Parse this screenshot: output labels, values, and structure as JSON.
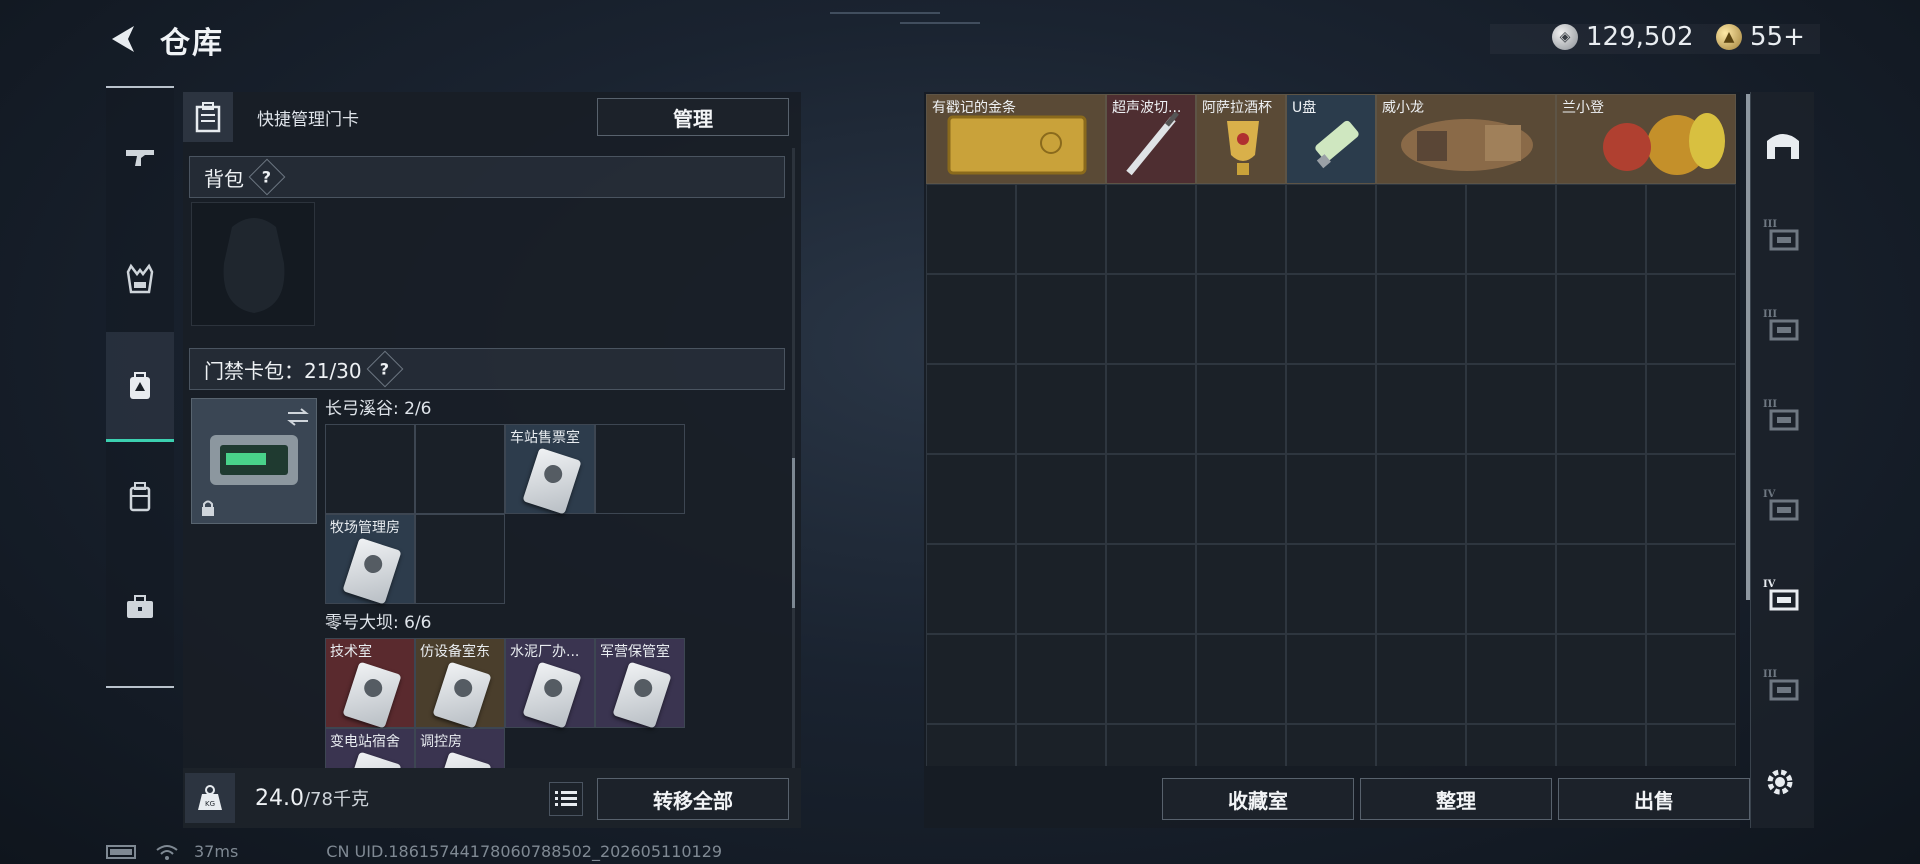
{
  "header": {
    "title": "仓库",
    "silver_amount": "129,502",
    "gold_amount": "55+"
  },
  "left_nav": [
    {
      "icon": "pistol-icon"
    },
    {
      "icon": "vest-icon"
    },
    {
      "icon": "keycard-bag-icon",
      "active": true
    },
    {
      "icon": "backpack-icon"
    },
    {
      "icon": "toolbox-icon"
    }
  ],
  "left_panel": {
    "quick_label": "快捷管理门卡",
    "manage_label": "管理",
    "backpack_section": "背包",
    "keycard_section": "门禁卡包：21/30",
    "help_mark": "?",
    "groups": [
      {
        "title": "长弓溪谷: 2/6",
        "cards": [
          {
            "name": "",
            "color": "empty"
          },
          {
            "name": "",
            "color": "empty"
          },
          {
            "name": "车站售票室",
            "color": "blue"
          },
          {
            "name": "",
            "color": "empty"
          },
          {
            "name": "牧场管理房",
            "color": "blue"
          },
          {
            "name": "",
            "color": "empty"
          }
        ]
      },
      {
        "title": "零号大坝: 6/6",
        "cards": [
          {
            "name": "技术室",
            "color": "red"
          },
          {
            "name": "仿设备室东",
            "color": "gold"
          },
          {
            "name": "水泥厂办...",
            "color": "purple"
          },
          {
            "name": "军营保管室",
            "color": "purple"
          },
          {
            "name": "变电站宿舍",
            "color": "purple"
          },
          {
            "name": "调控房",
            "color": "purple"
          }
        ]
      }
    ],
    "weight_current": "24.0",
    "weight_capacity": "/78千克",
    "transfer_label": "转移全部"
  },
  "storage": {
    "items": [
      {
        "name": "有戳记的金条",
        "color": "gold"
      },
      {
        "name": "超声波切...",
        "color": "red"
      },
      {
        "name": "阿萨拉酒杯",
        "color": "gold"
      },
      {
        "name": "U盘",
        "color": "blue"
      },
      {
        "name": "威小龙",
        "color": "gold"
      },
      {
        "name": "兰小登",
        "color": "gold"
      }
    ],
    "buttons": {
      "collection": "收藏室",
      "sort": "整理",
      "sell": "出售"
    }
  },
  "right_nav": [
    {
      "icon": "vault-icon"
    },
    {
      "icon": "shelf-iii-icon",
      "tier": "III"
    },
    {
      "icon": "case-iii-icon",
      "tier": "III"
    },
    {
      "icon": "rack-iii-icon",
      "tier": "III"
    },
    {
      "icon": "folder-iv-icon",
      "tier": "IV"
    },
    {
      "icon": "gear-tier-iv-icon",
      "tier": "IV"
    },
    {
      "icon": "case-iii-alt-icon",
      "tier": "III"
    }
  ],
  "status": {
    "ping": "37ms",
    "uid": "CN UID.18615744178060788502_202605110129"
  }
}
